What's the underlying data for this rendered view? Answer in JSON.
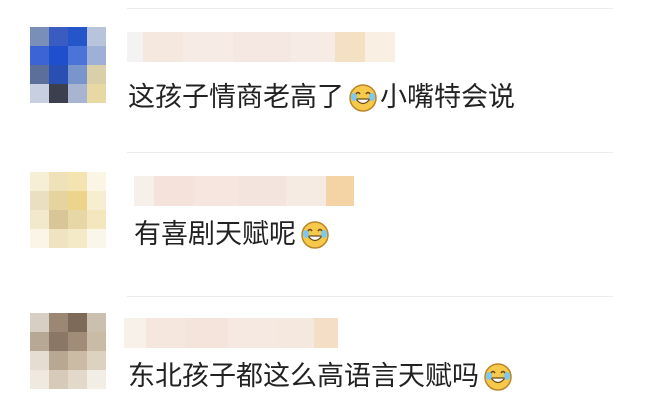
{
  "comments": [
    {
      "text": "这孩子情商老高了",
      "emoji": "laughing-crying-emoji",
      "text_after": "小嘴特会说"
    },
    {
      "text": "有喜剧天赋呢",
      "emoji": "laughing-crying-emoji",
      "text_after": ""
    },
    {
      "text": "东北孩子都这么高语言天赋吗",
      "emoji": "laughing-crying-emoji",
      "text_after": ""
    }
  ],
  "colors": {
    "avatar1": [
      "#7a8fb8",
      "#3a5bbf",
      "#2456c9",
      "#b8c4dc",
      "#3d64d4",
      "#1f4fcc",
      "#4a74d8",
      "#9fb0d6",
      "#5c6f9a",
      "#2a4fb2",
      "#7a94cc",
      "#d9cfa8",
      "#c7cfe0",
      "#3b3f4e",
      "#a7b5d0",
      "#e8d9a4"
    ],
    "avatar2": [
      "#f6efd6",
      "#efe2b8",
      "#f3e4b1",
      "#fbf5e6",
      "#eadfc0",
      "#e5d49d",
      "#ecd48a",
      "#f7eed2",
      "#f2e8cb",
      "#d8c698",
      "#e7d7a6",
      "#f4e7be",
      "#faf5e6",
      "#efe3c1",
      "#f5eac8",
      "#fbf6ea"
    ],
    "avatar3": [
      "#d8cfc4",
      "#9c8674",
      "#7e6a58",
      "#cbbfb0",
      "#b7a895",
      "#8a7766",
      "#a18c78",
      "#c9bba6",
      "#e5ddd2",
      "#b9a891",
      "#cbbba4",
      "#ddd1c0",
      "#efe9e0",
      "#d7cab8",
      "#e3d9ca",
      "#f2ede5"
    ]
  }
}
